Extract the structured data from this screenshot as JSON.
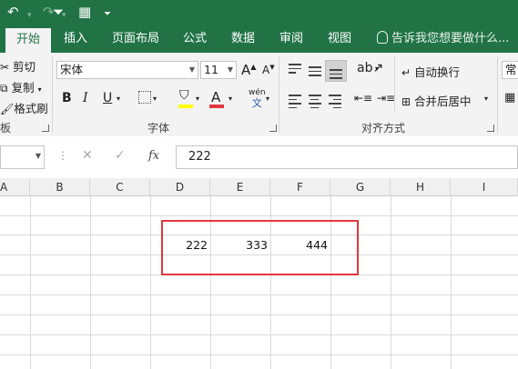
{
  "ribbon_tabs": {
    "home": "开始",
    "insert": "插入",
    "page_layout": "页面布局",
    "formulas": "公式",
    "data": "数据",
    "review": "审阅",
    "view": "视图",
    "tell_me": "告诉我您想要做什么..."
  },
  "clipboard": {
    "cut": "剪切",
    "copy": "复制",
    "format_painter": "格式刷",
    "group_label": "板"
  },
  "font": {
    "name": "宋体",
    "size": "11",
    "bold": "B",
    "italic": "I",
    "underline": "U",
    "grow": "A",
    "shrink": "A",
    "font_color": "A",
    "phonetic": "wén",
    "phonetic_sub": "文",
    "group_label": "字体"
  },
  "alignment": {
    "wrap_text": "自动换行",
    "merge_center": "合并后居中",
    "group_label": "对齐方式"
  },
  "number": {
    "format": "常"
  },
  "formula_bar": {
    "fx": "fx",
    "value": "222"
  },
  "columns": [
    "A",
    "B",
    "C",
    "D",
    "E",
    "F",
    "G",
    "H",
    "I"
  ],
  "cells": {
    "D3": "222",
    "E3": "333",
    "F3": "444"
  },
  "colors": {
    "accent": "#217346",
    "highlight_box": "#e0383e",
    "fill_yellow": "#ffff00",
    "font_red": "#e0383e"
  }
}
